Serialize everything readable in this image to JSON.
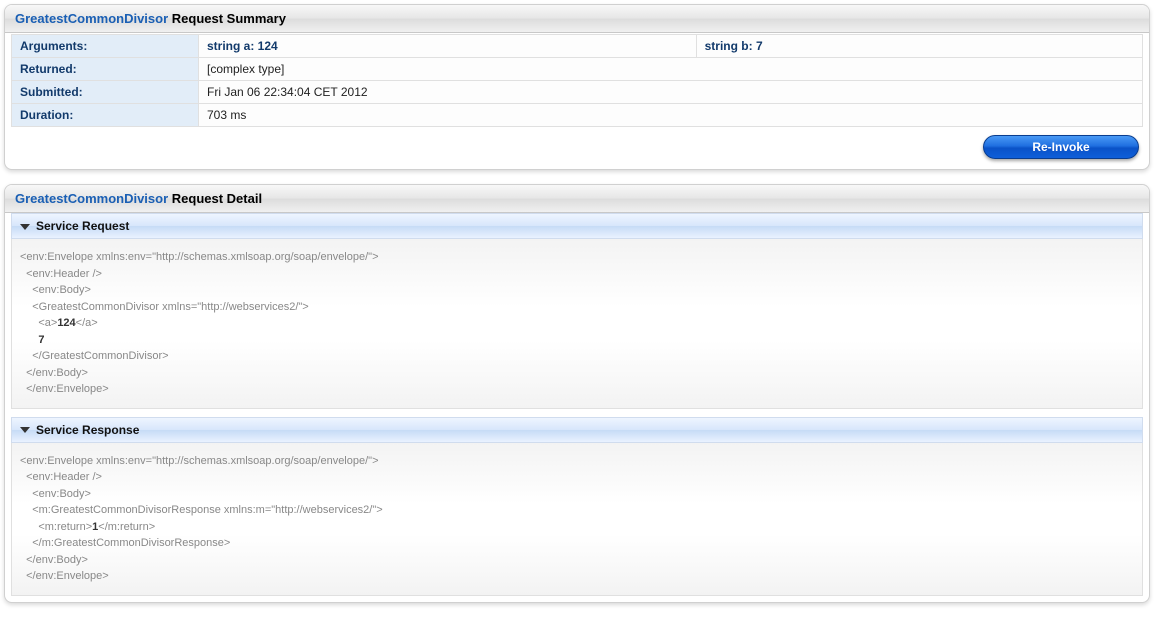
{
  "summary": {
    "operation": "GreatestCommonDivisor",
    "title_suffix": " Request Summary",
    "rows": {
      "arguments_label": "Arguments:",
      "arg_a": "string a: 124",
      "arg_b": "string b: 7",
      "returned_label": "Returned:",
      "returned_value": "[complex type]",
      "submitted_label": "Submitted:",
      "submitted_value": "Fri Jan 06 22:34:04 CET 2012",
      "duration_label": "Duration:",
      "duration_value": "703 ms"
    },
    "reinvoke_label": "Re-Invoke"
  },
  "detail": {
    "operation": "GreatestCommonDivisor",
    "title_suffix": " Request Detail",
    "request_section": "Service Request",
    "response_section": "Service Response",
    "request_xml": "<env:Envelope xmlns:env=\"http://schemas.xmlsoap.org/soap/envelope/\">\n  <env:Header />\n    <env:Body>\n    <GreatestCommonDivisor xmlns=\"http://webservices2/\">\n      <a><b>124</b></a>\n      <b><b>7</b></b>\n    </GreatestCommonDivisor>\n  </env:Body>\n  </env:Envelope>",
    "response_xml": "<env:Envelope xmlns:env=\"http://schemas.xmlsoap.org/soap/envelope/\">\n  <env:Header />\n    <env:Body>\n    <m:GreatestCommonDivisorResponse xmlns:m=\"http://webservices2/\">\n      <m:return><b>1</b></m:return>\n    </m:GreatestCommonDivisorResponse>\n  </env:Body>\n  </env:Envelope>"
  }
}
